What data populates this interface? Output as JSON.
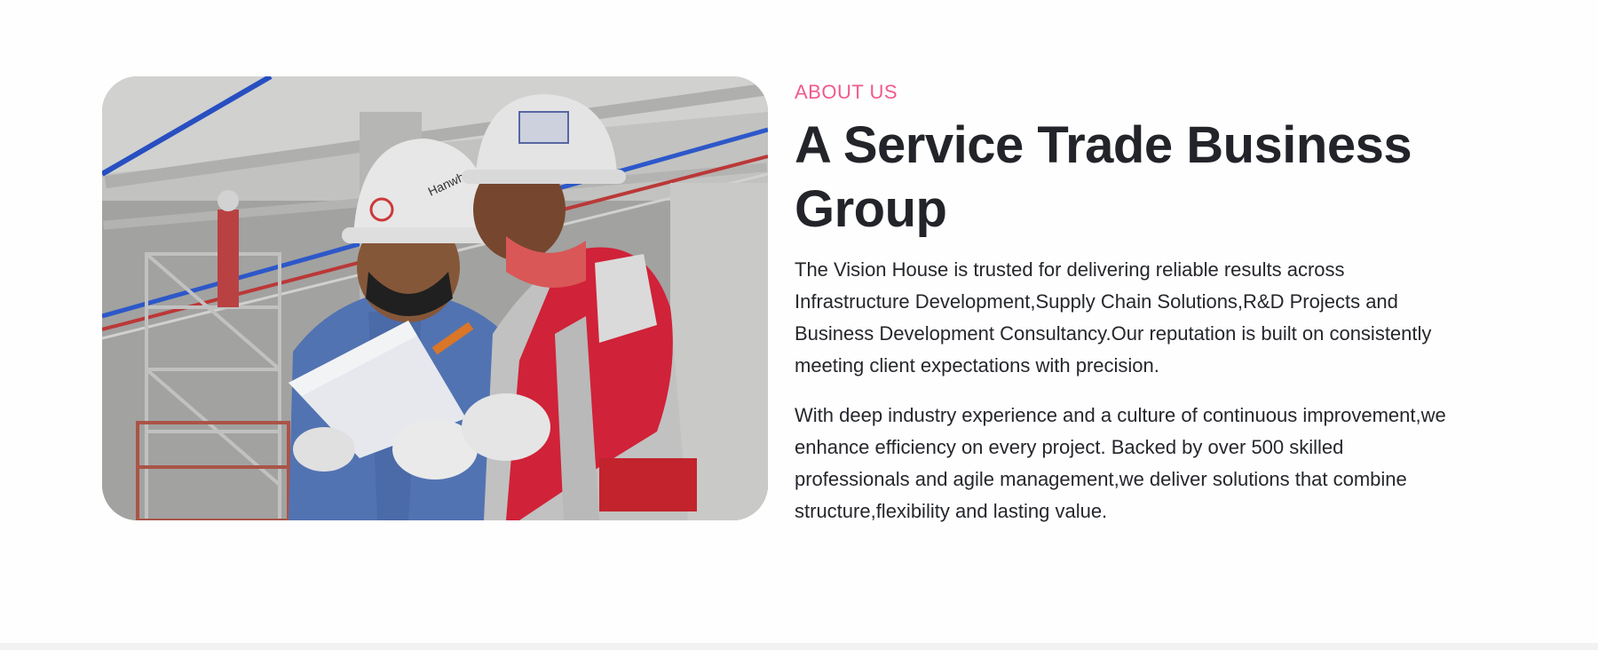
{
  "about": {
    "eyebrow": "ABOUT US",
    "heading": "A Service Trade Business Group",
    "paragraphs": [
      "The Vision House is trusted for delivering reliable results across Infrastructure Development,Supply Chain Solutions,R&D Projects and Business Development Consultancy.Our reputation is built on consistently meeting client expectations with precision.",
      "With deep industry experience and a culture of continuous improvement,we enhance efficiency on every project. Backed by over 500 skilled professionals and agile management,we deliver solutions that combine structure,flexibility and lasting value."
    ],
    "photo_helmet_text": "Hanwha"
  },
  "colors": {
    "accent": "#f05a8c",
    "heading": "#22242a",
    "body_text": "#25272c",
    "background": "#fefefe"
  }
}
